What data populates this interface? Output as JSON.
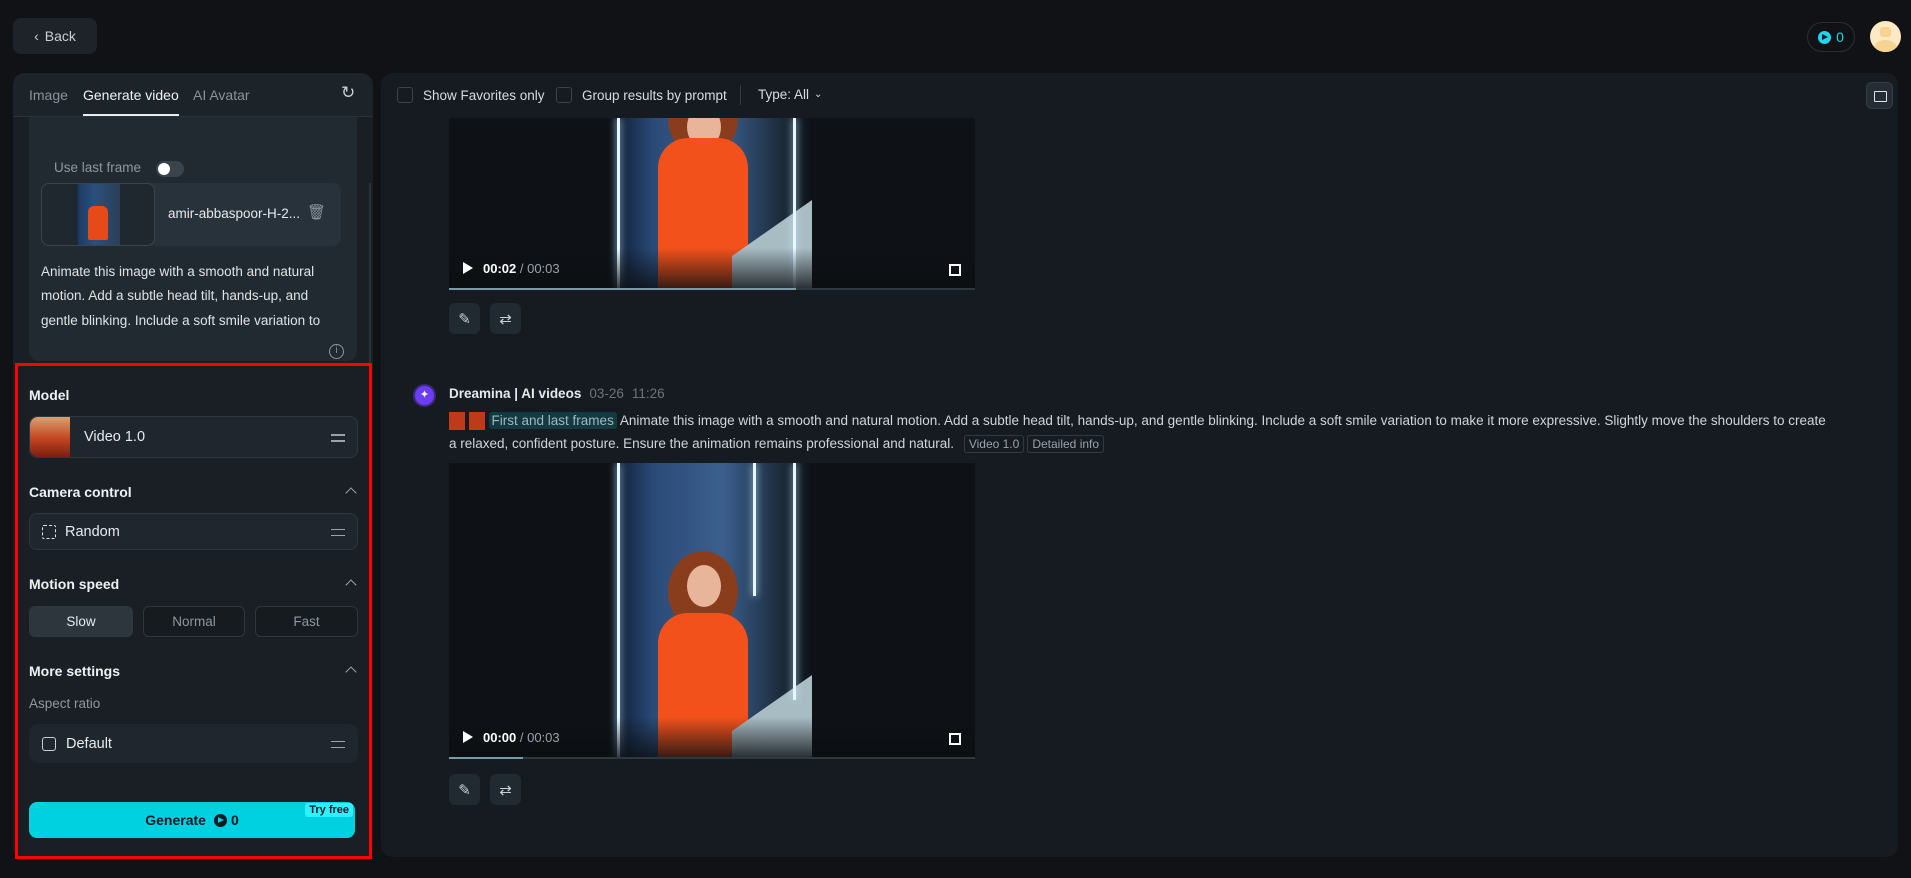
{
  "header": {
    "back_label": "Back",
    "credits": "0"
  },
  "left_panel": {
    "tabs": [
      {
        "label": "Image"
      },
      {
        "label": "Generate video"
      },
      {
        "label": "AI Avatar"
      }
    ],
    "use_last_frame_label": "Use last frame",
    "use_last_frame_on": false,
    "file_name": "amir-abbaspoor-H-2...",
    "prompt": "Animate this image with a smooth and natural motion. Add a subtle head tilt, hands-up, and gentle blinking. Include a soft smile variation to make it more expressive. Slightly move the shoulders to create a relaxed, confident posture.",
    "model_label": "Model",
    "model_value": "Video 1.0",
    "camera_label": "Camera control",
    "camera_value": "Random",
    "motion_label": "Motion speed",
    "motion_options": [
      "Slow",
      "Normal",
      "Fast"
    ],
    "motion_selected": "Slow",
    "more_label": "More settings",
    "aspect_label": "Aspect ratio",
    "aspect_value": "Default",
    "generate_label": "Generate",
    "generate_cost": "0",
    "try_free": "Try free"
  },
  "main": {
    "filters": {
      "favorites": "Show Favorites only",
      "group": "Group results by prompt",
      "type": "Type: All"
    },
    "videos": [
      {
        "current": "00:02",
        "total": "00:03",
        "progress": 0.66
      },
      {
        "current": "00:00",
        "total": "00:03",
        "progress": 0.14
      }
    ],
    "entry": {
      "author": "Dreamina | AI videos",
      "date": "03-26",
      "time": "11:26",
      "frames_tag": "First and last frames",
      "prompt": "Animate this image with a smooth and natural motion. Add a subtle head tilt, hands-up, and gentle blinking. Include a soft smile variation to make it more expressive. Slightly move the shoulders to create a relaxed, confident posture. Ensure the animation remains professional and natural.",
      "model_tag": "Video 1.0",
      "info_tag": "Detailed info"
    }
  },
  "colors": {
    "accent": "#00d1e0",
    "highlight": "#ff0000"
  }
}
